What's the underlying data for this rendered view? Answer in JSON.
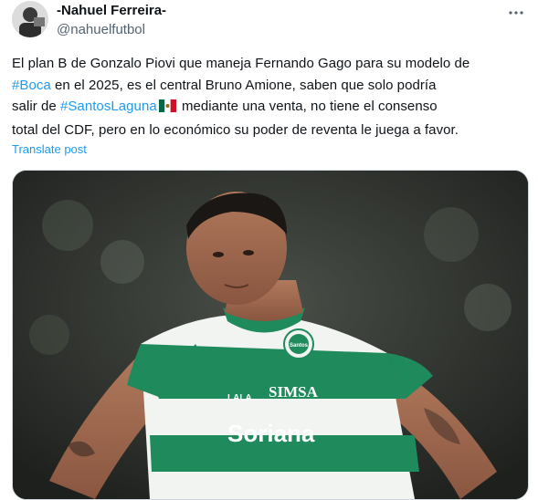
{
  "author": {
    "display_name": "-Nahuel Ferreira-",
    "handle": "@nahuelfutbol"
  },
  "post": {
    "lines": [
      [
        {
          "text": "El plan B de Gonzalo Piovi que maneja Fernando Gago para su modelo de",
          "tag": false
        }
      ],
      [
        {
          "text": "#Boca",
          "tag": true
        },
        {
          "text": " en el 2025, es el central Bruno Amione, saben que solo podría",
          "tag": false
        }
      ],
      [
        {
          "text": "salir de ",
          "tag": false
        },
        {
          "text": "#SantosLaguna",
          "tag": true
        },
        {
          "text": "🇲🇽",
          "flag": true
        },
        {
          "text": " mediante una venta, no tiene el consenso",
          "tag": false
        }
      ],
      [
        {
          "text": "total del CDF, pero en lo económico su poder de reventa le juega a favor.",
          "tag": false
        }
      ]
    ],
    "translate_label": "Translate post"
  },
  "media": {
    "jersey_text": {
      "sponsor_main": "Soriana",
      "sponsor_chest": "SIMSA",
      "sponsor_small": "LALA",
      "crest_text": "Santos"
    },
    "colors": {
      "jersey_green": "#1f8a5c",
      "jersey_white": "#f2f4f1",
      "background": "#2b2e2a"
    }
  },
  "icons": {
    "more": "more-horizontal-icon",
    "flag": "mexico-flag-icon"
  }
}
